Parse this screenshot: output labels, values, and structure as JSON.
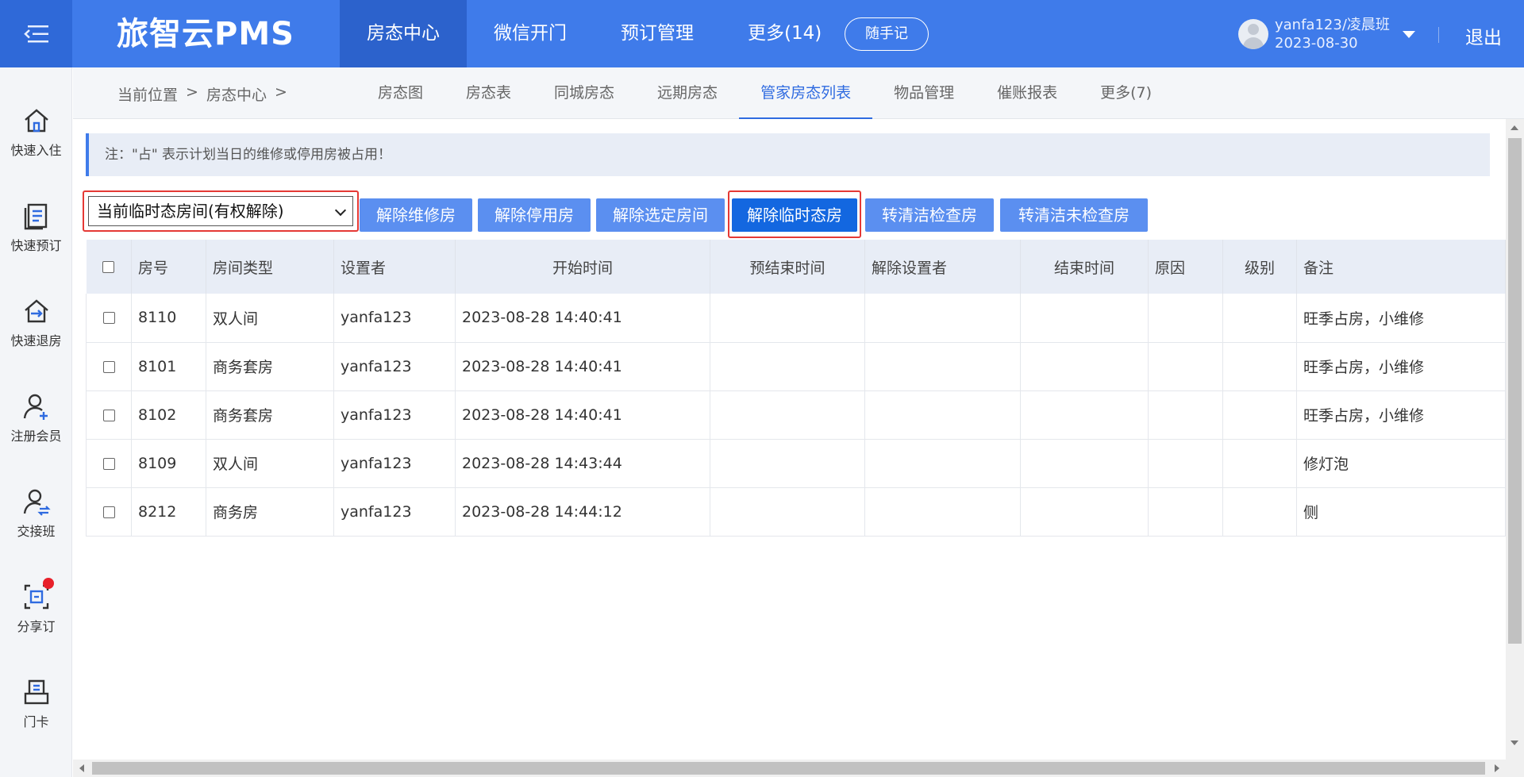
{
  "app": {
    "logo": "旅智云PMS"
  },
  "topnav": {
    "items": [
      {
        "label": "房态中心",
        "active": true
      },
      {
        "label": "微信开门",
        "active": false
      },
      {
        "label": "预订管理",
        "active": false
      },
      {
        "label": "更多(14)",
        "active": false
      }
    ],
    "notes_button": "随手记",
    "user_name": "yanfa123/凌晨班",
    "user_date": "2023-08-30",
    "logout": "退出"
  },
  "sidebar": {
    "items": [
      {
        "label": "快速入住",
        "icon": "home-icon"
      },
      {
        "label": "快速预订",
        "icon": "document-icon"
      },
      {
        "label": "快速退房",
        "icon": "checkout-house-icon"
      },
      {
        "label": "注册会员",
        "icon": "add-user-icon"
      },
      {
        "label": "交接班",
        "icon": "shift-handover-icon"
      },
      {
        "label": "分享订",
        "icon": "share-order-icon"
      },
      {
        "label": "门卡",
        "icon": "door-card-icon"
      }
    ]
  },
  "breadcrumb": {
    "prefix": "当前位置",
    "sep": ">",
    "current": "房态中心",
    "sep2": ">"
  },
  "subtabs": [
    {
      "label": "房态图",
      "active": false
    },
    {
      "label": "房态表",
      "active": false
    },
    {
      "label": "同城房态",
      "active": false
    },
    {
      "label": "远期房态",
      "active": false
    },
    {
      "label": "管家房态列表",
      "active": true
    },
    {
      "label": "物品管理",
      "active": false
    },
    {
      "label": "催账报表",
      "active": false
    },
    {
      "label": "更多(7)",
      "active": false
    }
  ],
  "notice": "注：\"占\" 表示计划当日的维修或停用房被占用！",
  "toolbar": {
    "select_value": "当前临时态房间(有权解除)",
    "buttons": [
      "解除维修房",
      "解除停用房",
      "解除选定房间",
      "解除临时态房",
      "转清洁检查房",
      "转清洁未检查房"
    ]
  },
  "table": {
    "headers": [
      "房号",
      "房间类型",
      "设置者",
      "开始时间",
      "预结束时间",
      "解除设置者",
      "结束时间",
      "原因",
      "级别",
      "备注"
    ],
    "rows": [
      {
        "room": "8110",
        "type": "双人间",
        "setter": "yanfa123",
        "start": "2023-08-28 14:40:41",
        "note": "旺季占房，小维修"
      },
      {
        "room": "8101",
        "type": "商务套房",
        "setter": "yanfa123",
        "start": "2023-08-28 14:40:41",
        "note": "旺季占房，小维修"
      },
      {
        "room": "8102",
        "type": "商务套房",
        "setter": "yanfa123",
        "start": "2023-08-28 14:40:41",
        "note": "旺季占房，小维修"
      },
      {
        "room": "8109",
        "type": "双人间",
        "setter": "yanfa123",
        "start": "2023-08-28 14:43:44",
        "note": "修灯泡"
      },
      {
        "room": "8212",
        "type": "商务房",
        "setter": "yanfa123",
        "start": "2023-08-28 14:44:12",
        "note": "侧"
      }
    ]
  },
  "colors": {
    "primary": "#3f7bea",
    "active_nav": "#2c62cc",
    "button": "#5b8ff0",
    "button_dark": "#1367e0",
    "highlight_border": "#e53935",
    "badge": "#e8202a"
  }
}
